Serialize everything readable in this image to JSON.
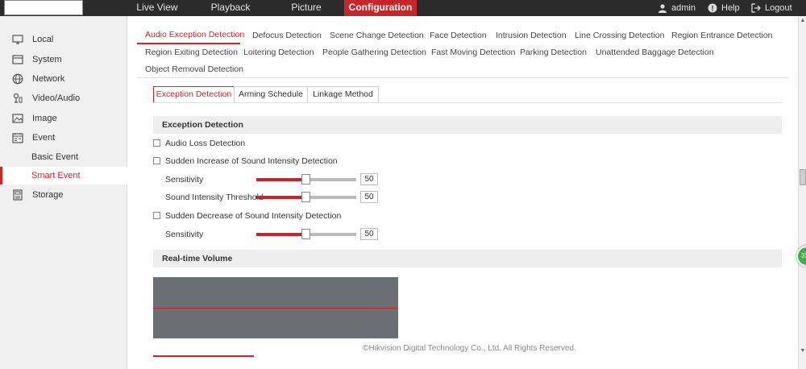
{
  "topnav": {
    "items": [
      {
        "label": "Live View"
      },
      {
        "label": "Playback"
      },
      {
        "label": "Picture"
      },
      {
        "label": "Configuration"
      }
    ],
    "user": "admin",
    "help": "Help",
    "logout": "Logout"
  },
  "sidebar": {
    "items": [
      {
        "label": "Local",
        "icon": "monitor-icon"
      },
      {
        "label": "System",
        "icon": "system-icon"
      },
      {
        "label": "Network",
        "icon": "globe-icon"
      },
      {
        "label": "Video/Audio",
        "icon": "video-audio-icon"
      },
      {
        "label": "Image",
        "icon": "image-icon"
      },
      {
        "label": "Event",
        "icon": "event-icon"
      },
      {
        "label": "Basic Event"
      },
      {
        "label": "Smart Event"
      },
      {
        "label": "Storage",
        "icon": "storage-icon"
      }
    ],
    "selected": "Smart Event"
  },
  "tabs": {
    "row1": [
      "Audio Exception Detection",
      "Defocus Detection",
      "Scene Change Detection",
      "Face Detection",
      "Intrusion Detection",
      "Line Crossing Detection",
      "Region Entrance Detection"
    ],
    "row2": [
      "Region Exiting Detection",
      "Loitering Detection",
      "People Gathering Detection",
      "Fast Moving Detection",
      "Parking Detection",
      "Unattended Baggage Detection"
    ],
    "row3": [
      "Object Removal Detection"
    ],
    "active": "Audio Exception Detection"
  },
  "subtabs": [
    "Exception Detection",
    "Arming Schedule",
    "Linkage Method"
  ],
  "exception": {
    "title": "Exception Detection",
    "audio_loss": "Audio Loss Detection",
    "sudden_increase": "Sudden Increase of Sound Intensity Detection",
    "sensitivity_label": "Sensitivity",
    "threshold_label": "Sound Intensity Threshold",
    "sudden_decrease": "Sudden Decrease of Sound Intensity Detection",
    "increase_sensitivity": "50",
    "increase_threshold": "50",
    "decrease_sensitivity": "50"
  },
  "volume": {
    "title": "Real-time Volume"
  },
  "footer": "©Hikvision Digital Technology Co., Ltd. All Rights Reserved.",
  "badge": "32",
  "colors": {
    "accent": "#c6262b",
    "topbar": "#2b2b2b",
    "volume_bg": "#6b6e73"
  }
}
